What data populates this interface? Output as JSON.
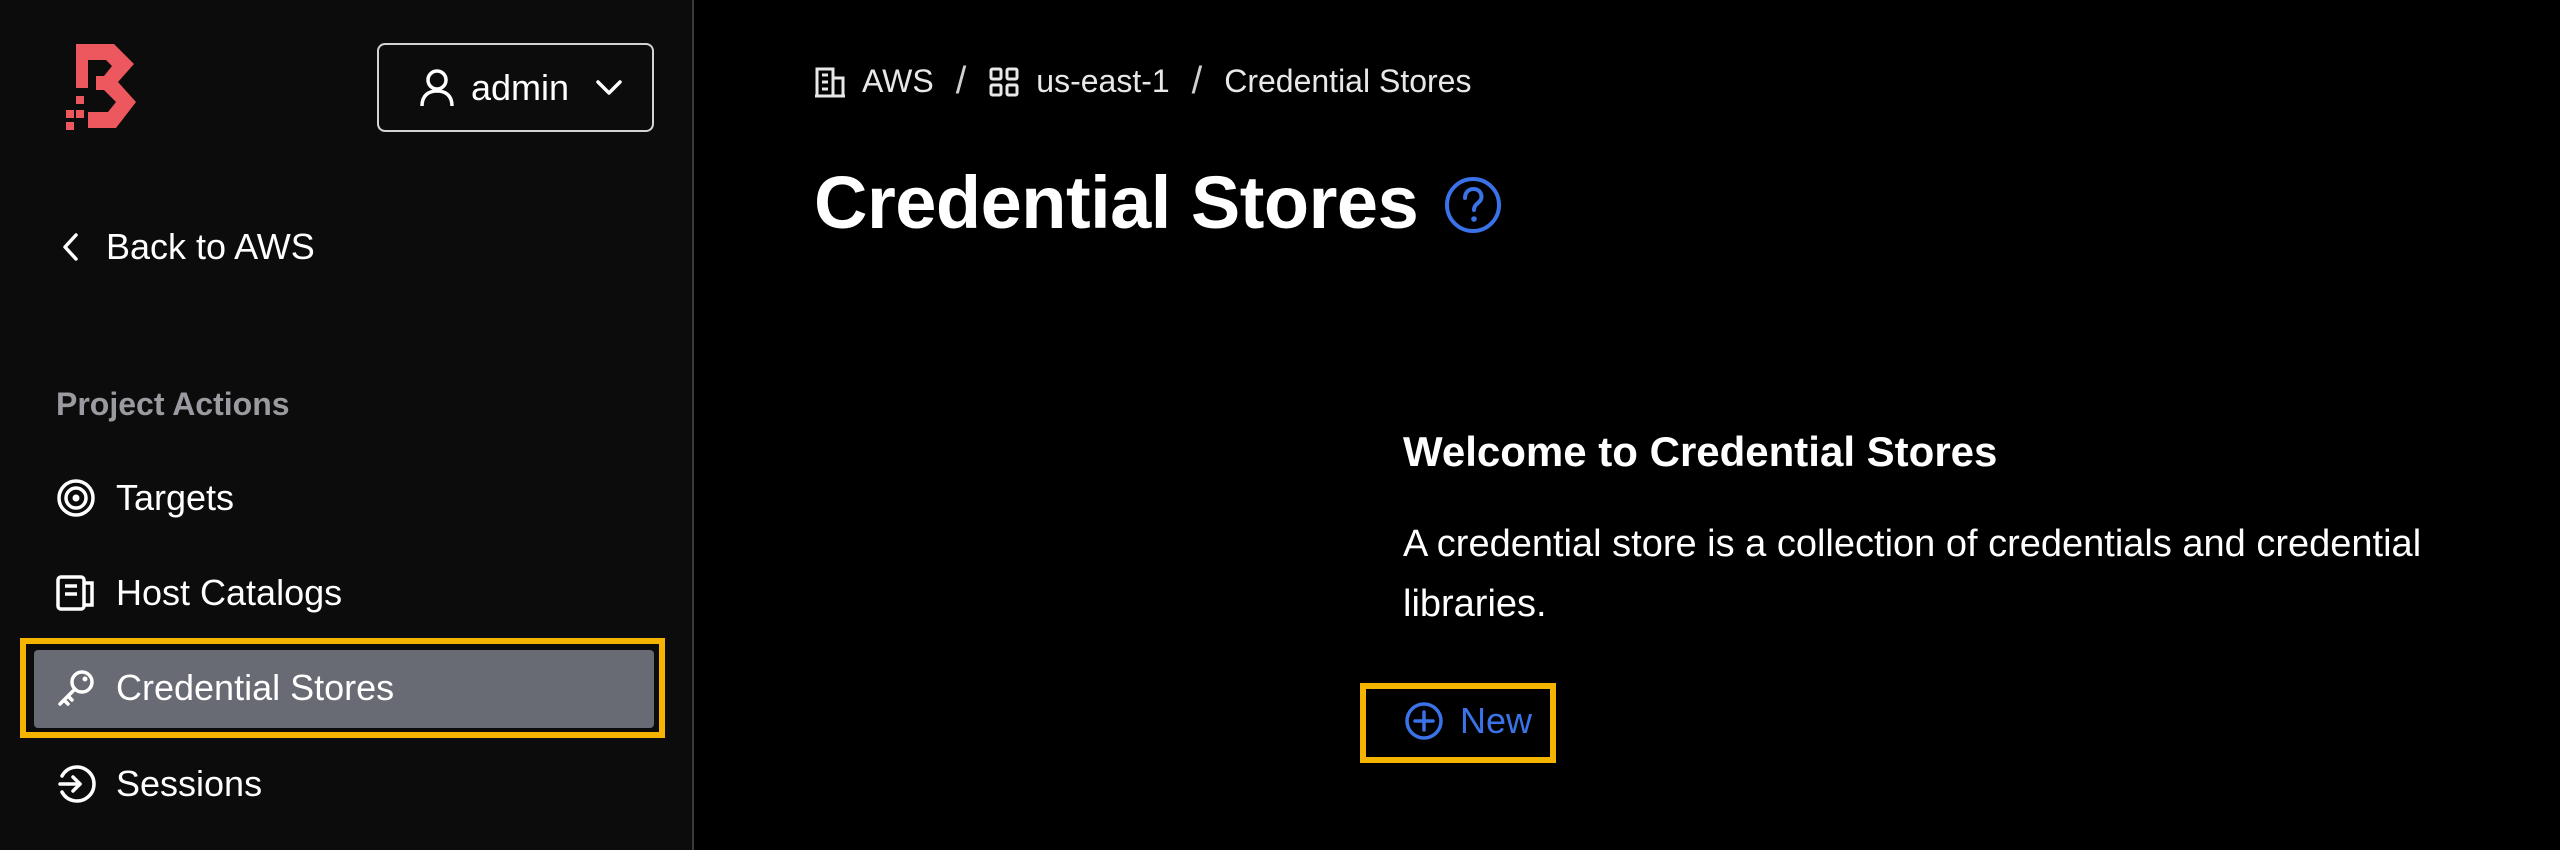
{
  "user": {
    "name": "admin"
  },
  "sidebar": {
    "back_label": "Back to AWS",
    "section_title": "Project Actions",
    "items": [
      {
        "label": "Targets",
        "icon": "target-icon"
      },
      {
        "label": "Host Catalogs",
        "icon": "host-catalog-icon"
      },
      {
        "label": "Credential Stores",
        "icon": "key-icon",
        "active": true
      },
      {
        "label": "Sessions",
        "icon": "sessions-icon"
      }
    ]
  },
  "breadcrumbs": [
    {
      "label": "AWS",
      "icon": "building-icon"
    },
    {
      "label": "us-east-1",
      "icon": "grid-icon"
    },
    {
      "label": "Credential Stores"
    }
  ],
  "page": {
    "title": "Credential Stores",
    "empty_title": "Welcome to Credential Stores",
    "empty_description": "A credential store is a collection of credentials and credential libraries.",
    "new_label": "New"
  },
  "colors": {
    "brand": "#ec585d",
    "accent": "#3a72e8",
    "highlight": "#f5b400",
    "active_bg": "#686a74"
  }
}
